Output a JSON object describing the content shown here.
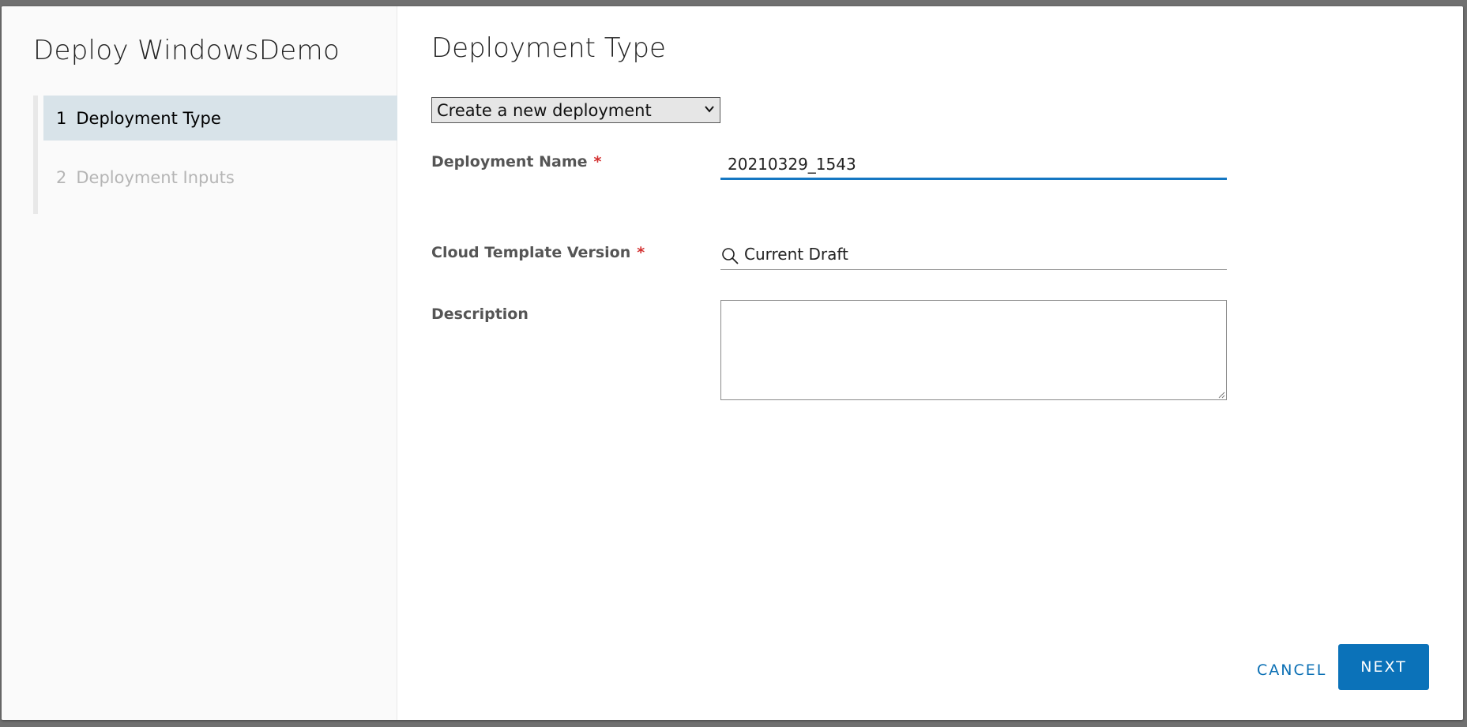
{
  "sidebar": {
    "title": "Deploy WindowsDemo",
    "steps": [
      {
        "number": "1",
        "label": "Deployment Type",
        "state": "active"
      },
      {
        "number": "2",
        "label": "Deployment Inputs",
        "state": "inactive"
      }
    ]
  },
  "main": {
    "title": "Deployment Type",
    "deployment_mode_select": {
      "selected": "Create a new deployment"
    },
    "fields": {
      "deployment_name": {
        "label": "Deployment Name",
        "required_mark": "*",
        "value": "20210329_1543"
      },
      "cloud_template_version": {
        "label": "Cloud Template Version",
        "required_mark": "*",
        "value": "Current Draft"
      },
      "description": {
        "label": "Description",
        "value": ""
      }
    }
  },
  "footer": {
    "cancel_label": "CANCEL",
    "next_label": "NEXT"
  },
  "colors": {
    "accent": "#0b72b9",
    "active_step_bg": "#d8e3e9",
    "required": "#d32f2f"
  },
  "icons": {
    "select_chevron": "chevron-down-icon",
    "version_search": "search-icon",
    "textarea_resize": "resize-handle-icon"
  }
}
